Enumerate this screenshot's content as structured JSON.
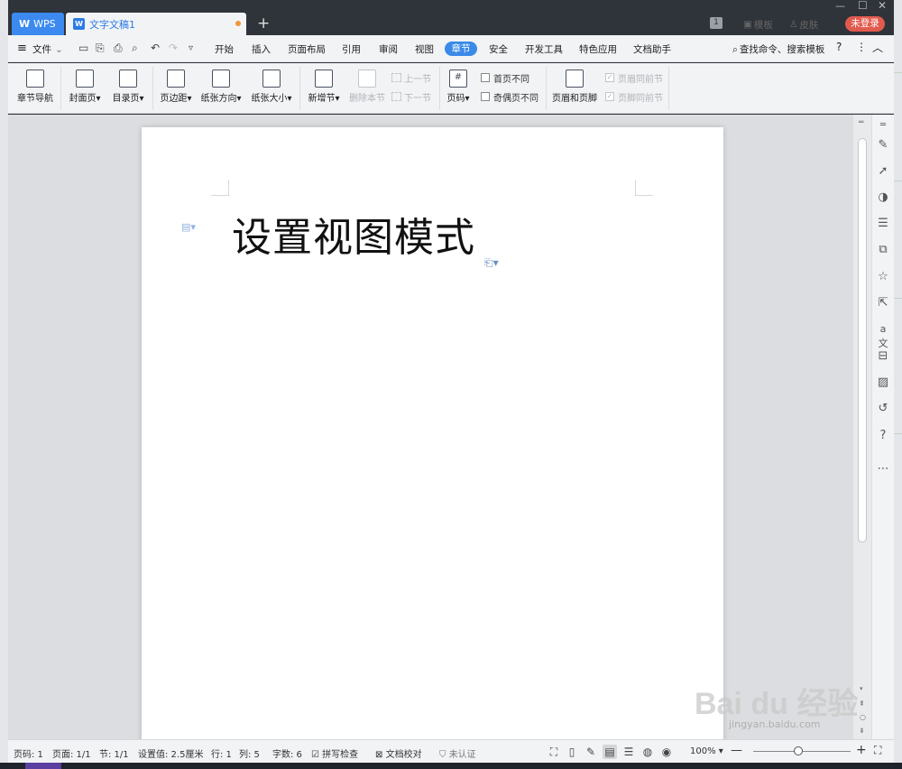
{
  "title_bar": {
    "wps_tab": "WPS",
    "doc_tab": "文字文稿1",
    "badge": "1",
    "template_btn": "模板",
    "skin_btn": "皮肤",
    "login_btn": "未登录"
  },
  "menu": {
    "file": "文件",
    "items": [
      "开始",
      "插入",
      "页面布局",
      "引用",
      "审阅",
      "视图",
      "章节",
      "安全",
      "开发工具",
      "特色应用",
      "文档助手"
    ],
    "active_item": "章节",
    "search": "查找命令、搜索模板"
  },
  "ribbon": {
    "chapter_nav": "章节导航",
    "cover_page": "封面页",
    "toc_page": "目录页",
    "margins": "页边距",
    "orientation": "纸张方向",
    "paper_size": "纸张大小",
    "new_section": "新增节",
    "delete_section": "删除本节",
    "prev_section": "上一节",
    "next_section": "下一节",
    "page_number": "页码",
    "first_page_diff": "首页不同",
    "odd_even_diff": "奇偶页不同",
    "header_footer": "页眉和页脚",
    "header_same_prev": "页眉同前节",
    "footer_same_prev": "页脚同前节"
  },
  "document": {
    "title_text": "设置视图模式"
  },
  "sidebar_icons": [
    "brush-icon",
    "cursor-icon",
    "shapes-icon",
    "settings-sliders-icon",
    "image-gallery-icon",
    "star-icon",
    "share-icon",
    "translate-icon",
    "archive-icon",
    "picture-icon",
    "history-icon",
    "help-icon",
    "more-icon"
  ],
  "status": {
    "page_code": "页码: 1",
    "pages": "页面: 1/1",
    "section": "节: 1/1",
    "setting": "设置值: 2.5厘米",
    "row": "行: 1",
    "col": "列: 5",
    "chars": "字数: 6",
    "spell_check": "拼写检查",
    "doc_proof": "文档校对",
    "auth": "未认证",
    "zoom": "100%",
    "zoom_level_fraction": 0.5
  },
  "watermark": {
    "brand": "Bai du 经验",
    "url": "jingyan.baidu.com"
  }
}
